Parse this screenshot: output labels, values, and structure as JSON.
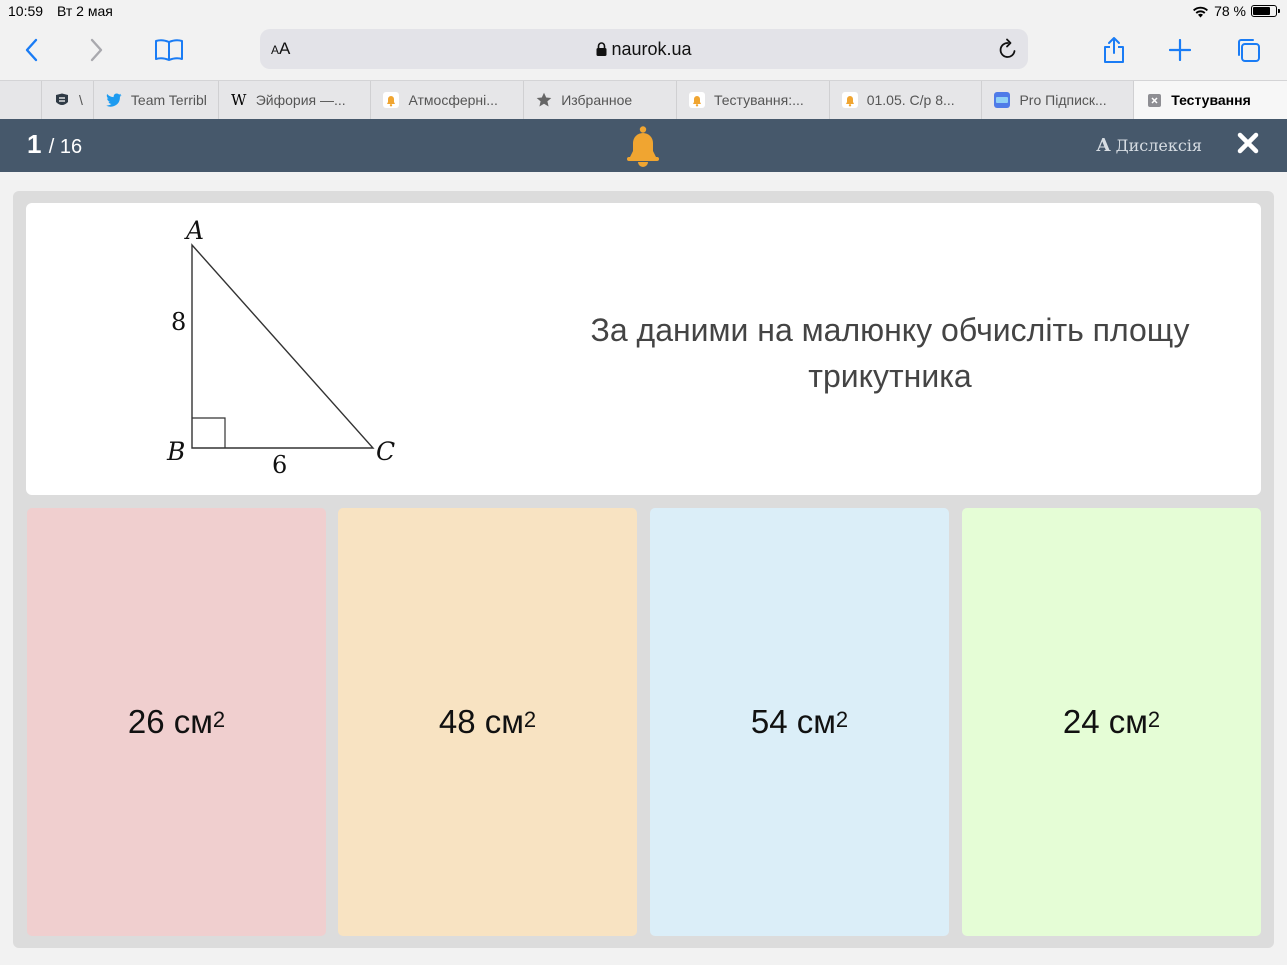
{
  "status_bar": {
    "time": "10:59",
    "date": "Вт 2 мая",
    "battery": "78 %"
  },
  "browser": {
    "url": "naurok.ua",
    "text_size_label": "AA",
    "tabs": [
      {
        "label": "",
        "icon": "globe-icon"
      },
      {
        "label": "\\",
        "icon": "helmet-icon"
      },
      {
        "label": "Team Terribl",
        "icon": "twitter-icon"
      },
      {
        "label": "Эйфория —...",
        "icon": "wikipedia-icon"
      },
      {
        "label": "Атмосферні...",
        "icon": "bell-icon"
      },
      {
        "label": "Избранное",
        "icon": "star-icon"
      },
      {
        "label": "Тестування:...",
        "icon": "bell-icon"
      },
      {
        "label": "01.05. С/р 8...",
        "icon": "bell-icon"
      },
      {
        "label": "Pro Підписк...",
        "icon": "card-icon"
      },
      {
        "label": "Тестування",
        "icon": "close-icon"
      }
    ]
  },
  "quiz_header": {
    "current": "1",
    "total": "/ 16",
    "dyslexia_label": "Дислексія"
  },
  "question": {
    "text": "За даними на малюнку обчисліть площу трикутника",
    "figure": {
      "vertex_a": "A",
      "vertex_b": "B",
      "vertex_c": "C",
      "side_ab": "8",
      "side_bc": "6"
    }
  },
  "answers": [
    {
      "value": "26 см",
      "sup": "2",
      "color": "#f0cfcf"
    },
    {
      "value": "48 см",
      "sup": "2",
      "color": "#f8e3c2"
    },
    {
      "value": "54 см",
      "sup": "2",
      "color": "#dbeef8"
    },
    {
      "value": "24 см",
      "sup": "2",
      "color": "#e5fdd6"
    }
  ],
  "colors": {
    "header_bg": "#46586b",
    "accent_blue": "#1a7cf5",
    "bell": "#f0a531"
  }
}
